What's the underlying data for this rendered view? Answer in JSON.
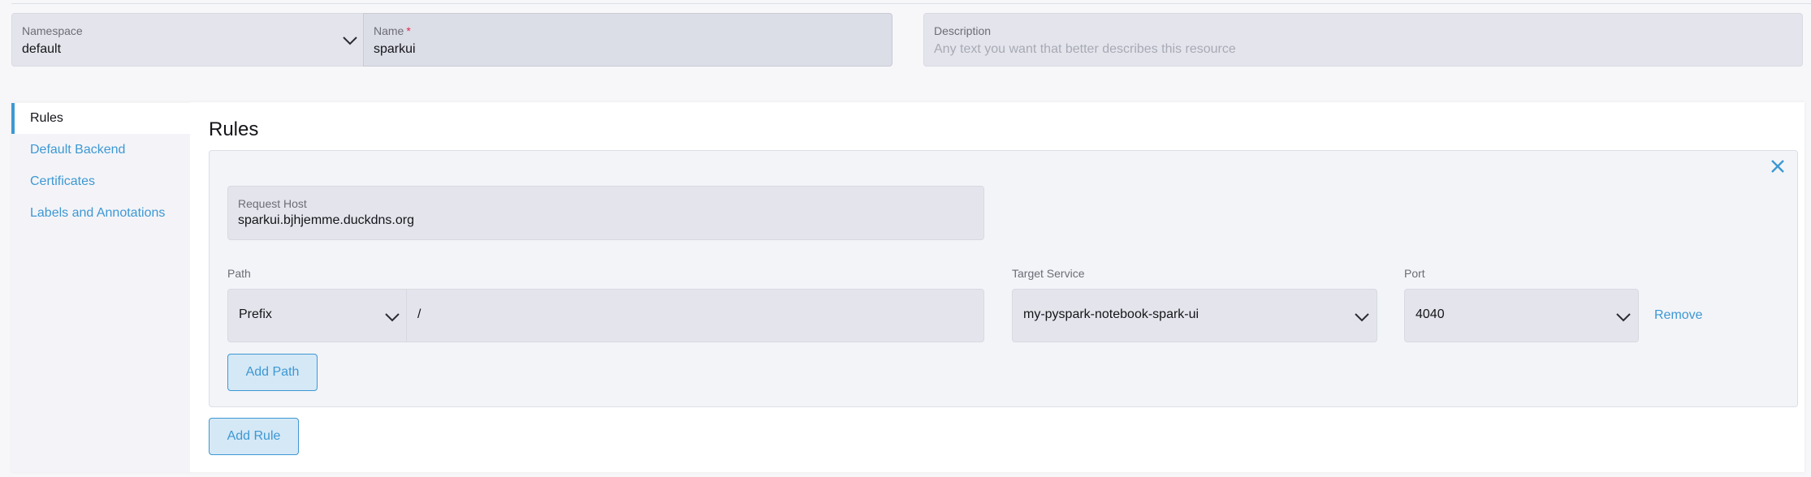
{
  "header": {
    "namespace": {
      "label": "Namespace",
      "value": "default"
    },
    "name": {
      "label": "Name",
      "required_mark": "*",
      "value": "sparkui"
    },
    "description": {
      "label": "Description",
      "placeholder": "Any text you want that better describes this resource"
    }
  },
  "tabs": [
    {
      "label": "Rules",
      "active": true
    },
    {
      "label": "Default Backend",
      "active": false
    },
    {
      "label": "Certificates",
      "active": false
    },
    {
      "label": "Labels and Annotations",
      "active": false
    }
  ],
  "rules": {
    "title": "Rules",
    "request_host": {
      "label": "Request Host",
      "value": "sparkui.bjhjemme.duckdns.org"
    },
    "path": {
      "label": "Path",
      "type": "Prefix",
      "value": "/"
    },
    "target_service": {
      "label": "Target Service",
      "value": "my-pyspark-notebook-spark-ui"
    },
    "port": {
      "label": "Port",
      "value": "4040"
    },
    "remove_label": "Remove",
    "add_path_label": "Add Path",
    "add_rule_label": "Add Rule"
  },
  "colors": {
    "accent": "#3d98d3",
    "required": "#e0284b"
  },
  "icons": {
    "close": "close-icon",
    "dropdown": "chevron-down-icon"
  }
}
